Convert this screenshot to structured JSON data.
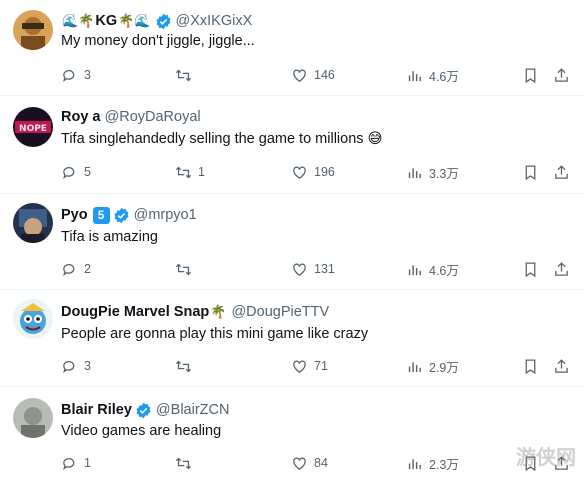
{
  "tweets": [
    {
      "name": "KG",
      "emoji_left": "🌊🌴",
      "emoji_right": "🌴🌊",
      "handle": "@XxIKGixX",
      "text": "My money don't jiggle, jiggle...",
      "replies": "3",
      "reposts": "",
      "likes": "146",
      "views": "4.6万"
    },
    {
      "name": "Roy a",
      "handle": "@RoyDaRoyal",
      "text": "Tifa singlehandedly selling the game to millions 😅",
      "replies": "5",
      "reposts": "1",
      "likes": "196",
      "views": "3.3万"
    },
    {
      "name": "Pyo",
      "badge": "5",
      "handle": "@mrpyo1",
      "text": "Tifa is amazing",
      "replies": "2",
      "reposts": "",
      "likes": "131",
      "views": "4.6万"
    },
    {
      "name": "DougPie Marvel Snap",
      "emoji_right": "🌴",
      "handle": "@DougPieTTV",
      "text": "People are gonna play this mini game like crazy",
      "replies": "3",
      "reposts": "",
      "likes": "71",
      "views": "2.9万"
    },
    {
      "name": "Blair Riley",
      "handle": "@BlairZCN",
      "text": "Video games are healing",
      "replies": "1",
      "reposts": "",
      "likes": "84",
      "views": "2.3万"
    }
  ],
  "icons": {
    "reply": "reply-icon",
    "repost": "repost-icon",
    "like": "heart-icon",
    "views": "views-icon",
    "bookmark": "bookmark-icon",
    "share": "share-icon",
    "verified": "verified-icon"
  },
  "colors": {
    "verified": "#1d9bf0",
    "muted": "#536471",
    "text": "#0f1419"
  },
  "watermark": "游侠网"
}
